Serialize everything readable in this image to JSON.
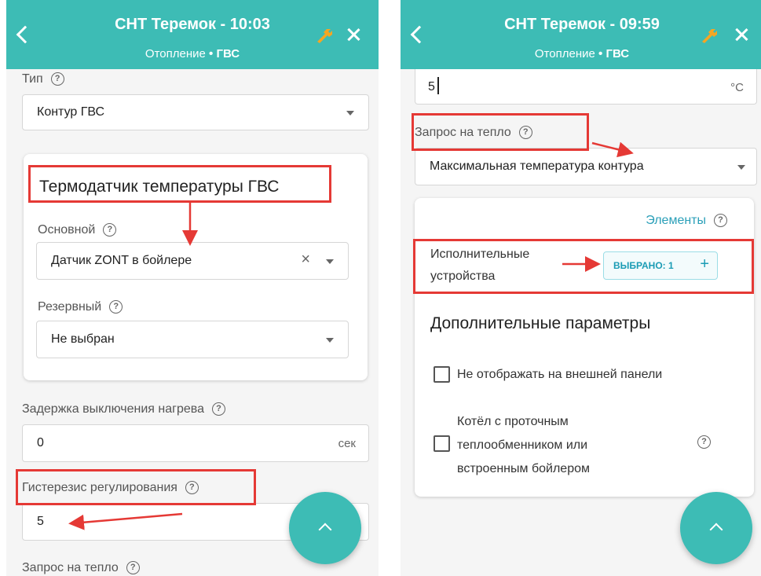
{
  "left": {
    "header": {
      "title": "СНТ Теремок - 10:03",
      "breadcrumb_1": "Отопление",
      "separator": "•",
      "breadcrumb_2": "ГВС"
    },
    "type_label": "Тип",
    "type_value": "Контур ГВС",
    "sensor_card": {
      "title": "Термодатчик температуры ГВС",
      "main_label": "Основной",
      "main_value": "Датчик ZONT в бойлере",
      "reserve_label": "Резервный",
      "reserve_value": "Не выбран"
    },
    "delay_label": "Задержка выключения нагрева",
    "delay_value": "0",
    "delay_unit": "сек",
    "hysteresis_label": "Гистерезис регулирования",
    "hysteresis_value": "5",
    "heat_request_label": "Запрос на тепло"
  },
  "right": {
    "header": {
      "title": "СНТ Теремок - 09:59",
      "breadcrumb_1": "Отопление",
      "separator": "•",
      "breadcrumb_2": "ГВС"
    },
    "hysteresis_value": "5",
    "hysteresis_unit": "°C",
    "heat_request_label": "Запрос на тепло",
    "heat_request_value": "Максимальная температура контура",
    "elements_link": "Элементы",
    "actuators_label_1": "Исполнительные",
    "actuators_label_2": "устройства",
    "actuators_chip": "ВЫБРАНО: 1",
    "actuators_plus": "+",
    "extra_title": "Дополнительные параметры",
    "checkbox_1": "Не отображать на внешней панели",
    "checkbox_2_line1": "Котёл с проточным",
    "checkbox_2_line2": "теплообменником или",
    "checkbox_2_line3": "встроенным бойлером"
  },
  "icons": {
    "back": "chevron-left-icon",
    "settings": "wrench-icon",
    "close": "close-icon",
    "help": "help-circle-icon",
    "fab": "chevron-up-icon"
  },
  "colors": {
    "header": "#3dbcb5",
    "wrench": "#f5a623",
    "highlight": "#e53935",
    "chip": "#1c9cb5",
    "link": "#2a9fb8"
  }
}
